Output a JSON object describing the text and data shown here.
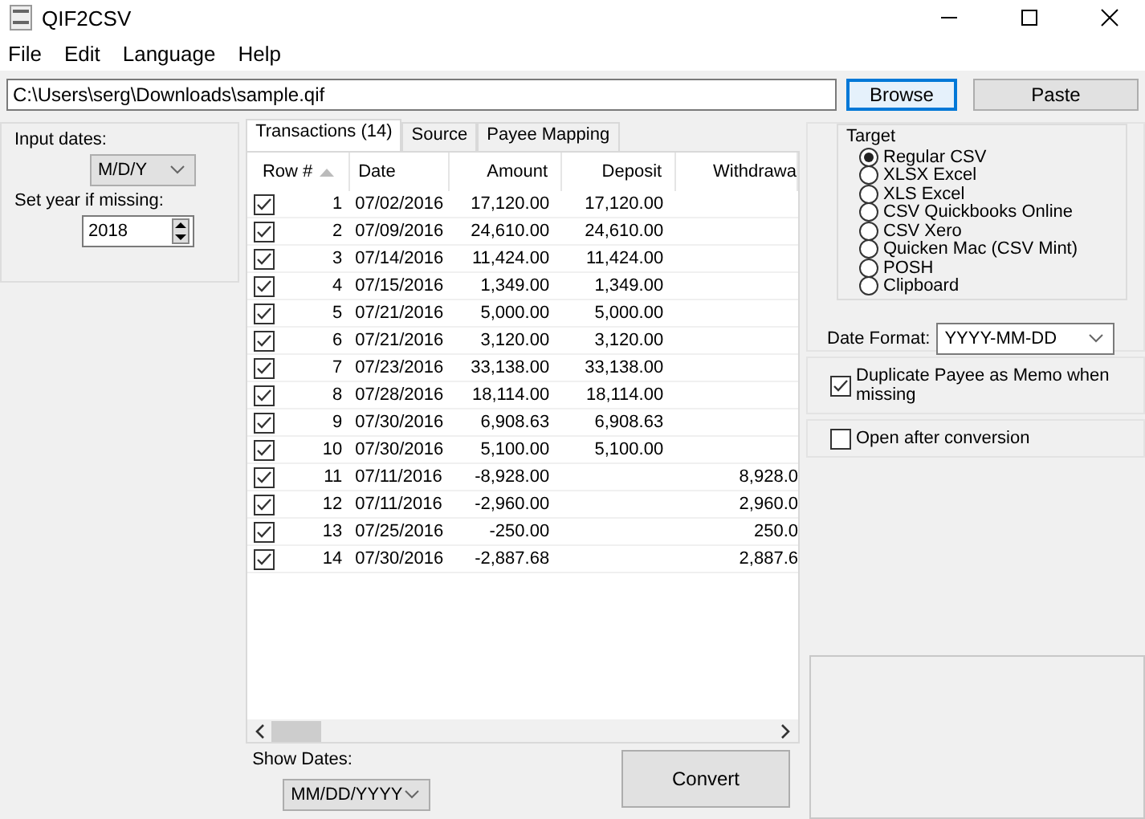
{
  "window": {
    "title": "QIF2CSV"
  },
  "menu": [
    "File",
    "Edit",
    "Language",
    "Help"
  ],
  "file_path": {
    "value": "C:\\Users\\serg\\Downloads\\sample.qif"
  },
  "buttons": [
    {
      "label": "Browse",
      "focused": true
    },
    {
      "label": "Paste",
      "focused": false
    }
  ],
  "input_dates": {
    "label": "Input dates:",
    "value": "M/D/Y"
  },
  "year": {
    "label": "Set year if missing:",
    "value": "2018"
  },
  "tabs": [
    {
      "label": "Transactions (14)",
      "selected": true
    },
    {
      "label": "Source",
      "selected": false
    },
    {
      "label": "Payee Mapping",
      "selected": false
    }
  ],
  "table": {
    "columns": [
      "Row #",
      "Date",
      "Amount",
      "Deposit",
      "Withdrawa"
    ],
    "rows": [
      {
        "checked": true,
        "row": "1",
        "date": "07/02/2016",
        "amount": "17,120.00",
        "deposit": "17,120.00",
        "withdrawal": ""
      },
      {
        "checked": true,
        "row": "2",
        "date": "07/09/2016",
        "amount": "24,610.00",
        "deposit": "24,610.00",
        "withdrawal": ""
      },
      {
        "checked": true,
        "row": "3",
        "date": "07/14/2016",
        "amount": "11,424.00",
        "deposit": "11,424.00",
        "withdrawal": ""
      },
      {
        "checked": true,
        "row": "4",
        "date": "07/15/2016",
        "amount": "1,349.00",
        "deposit": "1,349.00",
        "withdrawal": ""
      },
      {
        "checked": true,
        "row": "5",
        "date": "07/21/2016",
        "amount": "5,000.00",
        "deposit": "5,000.00",
        "withdrawal": ""
      },
      {
        "checked": true,
        "row": "6",
        "date": "07/21/2016",
        "amount": "3,120.00",
        "deposit": "3,120.00",
        "withdrawal": ""
      },
      {
        "checked": true,
        "row": "7",
        "date": "07/23/2016",
        "amount": "33,138.00",
        "deposit": "33,138.00",
        "withdrawal": ""
      },
      {
        "checked": true,
        "row": "8",
        "date": "07/28/2016",
        "amount": "18,114.00",
        "deposit": "18,114.00",
        "withdrawal": ""
      },
      {
        "checked": true,
        "row": "9",
        "date": "07/30/2016",
        "amount": "6,908.63",
        "deposit": "6,908.63",
        "withdrawal": ""
      },
      {
        "checked": true,
        "row": "10",
        "date": "07/30/2016",
        "amount": "5,100.00",
        "deposit": "5,100.00",
        "withdrawal": ""
      },
      {
        "checked": true,
        "row": "11",
        "date": "07/11/2016",
        "amount": "-8,928.00",
        "deposit": "",
        "withdrawal": "8,928.0"
      },
      {
        "checked": true,
        "row": "12",
        "date": "07/11/2016",
        "amount": "-2,960.00",
        "deposit": "",
        "withdrawal": "2,960.0"
      },
      {
        "checked": true,
        "row": "13",
        "date": "07/25/2016",
        "amount": "-250.00",
        "deposit": "",
        "withdrawal": "250.0"
      },
      {
        "checked": true,
        "row": "14",
        "date": "07/30/2016",
        "amount": "-2,887.68",
        "deposit": "",
        "withdrawal": "2,887.6"
      }
    ]
  },
  "show_dates": {
    "label": "Show Dates:",
    "value": "MM/DD/YYYY"
  },
  "convert_button": "Convert",
  "target": {
    "title": "Target",
    "options": [
      {
        "label": "Regular CSV",
        "selected": true
      },
      {
        "label": "XLSX Excel",
        "selected": false
      },
      {
        "label": "XLS Excel",
        "selected": false
      },
      {
        "label": "CSV Quickbooks Online",
        "selected": false
      },
      {
        "label": "CSV Xero",
        "selected": false
      },
      {
        "label": "Quicken Mac (CSV Mint)",
        "selected": false
      },
      {
        "label": "POSH",
        "selected": false
      },
      {
        "label": "Clipboard",
        "selected": false
      }
    ]
  },
  "date_format": {
    "label": "Date Format:",
    "value": "YYYY-MM-DD"
  },
  "options": [
    {
      "label": "Duplicate Payee as Memo when missing",
      "checked": true
    },
    {
      "label": "Open after conversion",
      "checked": false
    }
  ]
}
